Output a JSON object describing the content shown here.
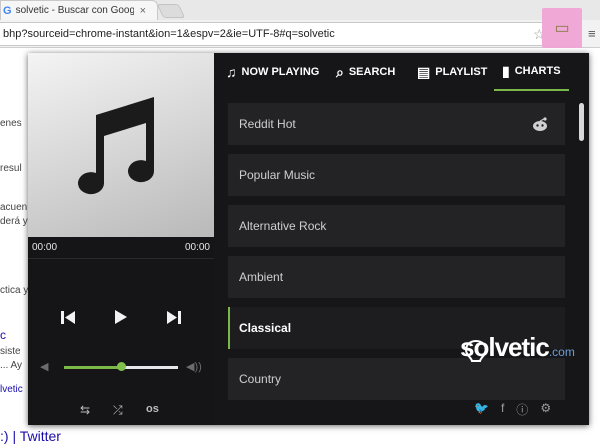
{
  "browser": {
    "tab_title": "solvetic - Buscar con Goog",
    "tab_favicon": "G",
    "tab_close": "×",
    "url": "bhp?sourceid=chrome-instant&ion=1&espv=2&ie=UTF-8#q=solvetic",
    "star": "☆",
    "menu": "≡"
  },
  "background_page": {
    "fragments": [
      "enes",
      "resul",
      "acuen",
      "derá y",
      "ctica y",
      "c",
      "siste",
      "... Ay",
      "lvetic"
    ],
    "twitter_link": ":) | Twitter"
  },
  "player": {
    "current_time": "00:00",
    "total_time": "00:00",
    "volume_fraction": 0.5
  },
  "nav": {
    "now_playing": "NOW PLAYING",
    "search": "SEARCH",
    "playlist": "PLAYLIST",
    "charts": "CHARTS",
    "active": "charts"
  },
  "charts_list": [
    {
      "label": "Reddit Hot",
      "selected": false
    },
    {
      "label": "Popular Music",
      "selected": false
    },
    {
      "label": "Alternative Rock",
      "selected": false
    },
    {
      "label": "Ambient",
      "selected": false
    },
    {
      "label": "Classical",
      "selected": true
    },
    {
      "label": "Country",
      "selected": false
    }
  ],
  "watermark": {
    "brand": "solvetic",
    "domain": ".com"
  },
  "colors": {
    "accent": "#7ab84a",
    "panel": "#161618",
    "list_item": "#232325",
    "extension_highlight": "#f0a8d6"
  }
}
